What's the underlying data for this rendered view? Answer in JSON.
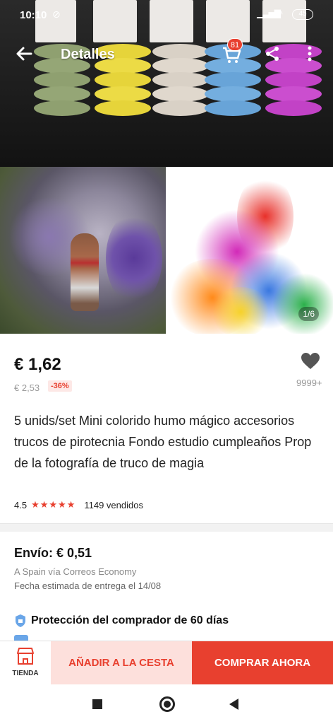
{
  "status_bar": {
    "time": "10:10",
    "sync_icon": "sync-off-icon",
    "battery": "45"
  },
  "header": {
    "title": "Detalles",
    "cart_count": "81"
  },
  "gallery": {
    "counter": "1/6"
  },
  "product": {
    "price": "€ 1,62",
    "old_price": "€ 2,53",
    "discount": "-36%",
    "wishlist_count": "9999+",
    "title": "5 unids/set Mini colorido humo mágico accesorios trucos de pirotecnia Fondo estudio cumpleaños Prop de la fotografía de truco de magia",
    "rating": "4.5",
    "stars": "★★★★★",
    "sold": "1149 vendidos"
  },
  "shipping": {
    "cost": "Envío: € 0,51",
    "from": "A Spain vía Correos Economy",
    "estimate": "Fecha estimada de entrega el 14/08"
  },
  "protection": {
    "label": "Protección del comprador de 60 días"
  },
  "actions": {
    "store_label": "TIENDA",
    "add_to_cart": "AÑADIR A LA CESTA",
    "buy_now": "COMPRAR AHORA"
  },
  "colors": {
    "accent": "#e8402f",
    "accent_light": "#fde0dc"
  }
}
